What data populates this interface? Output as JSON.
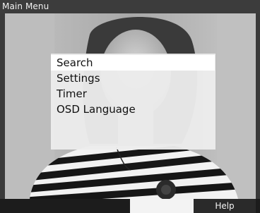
{
  "title": "Main Menu",
  "menu": {
    "items": [
      {
        "label": "Search",
        "selected": true
      },
      {
        "label": "Settings",
        "selected": false
      },
      {
        "label": "Timer",
        "selected": false
      },
      {
        "label": "OSD Language",
        "selected": false
      }
    ]
  },
  "footer": {
    "help_label": "Help"
  },
  "colors": {
    "title_bar": "#3c3c3c",
    "menu_panel": "#ececec",
    "selected_row": "#ffffff",
    "footer": "#1c1c1c"
  }
}
